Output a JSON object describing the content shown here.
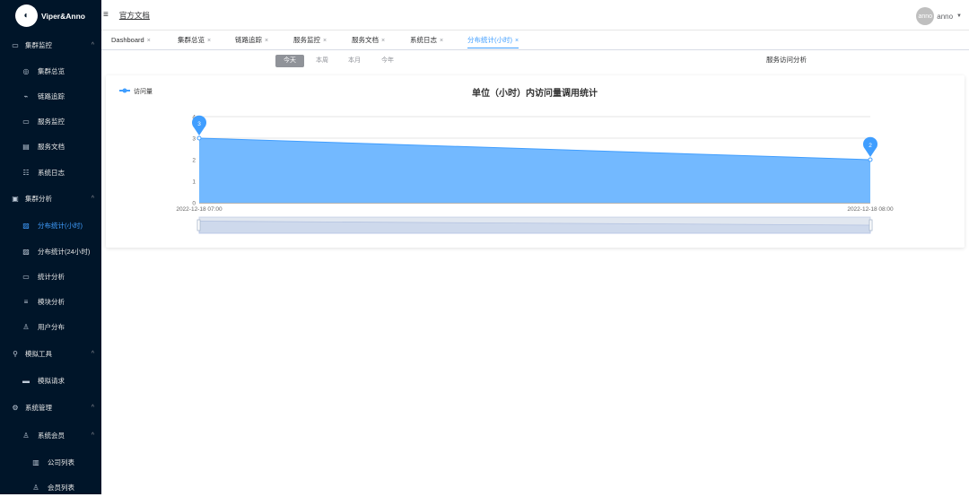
{
  "app": {
    "logo_text": "Viper&Anno"
  },
  "sidebar": {
    "items": [
      {
        "label": "集群监控",
        "icon": "monitor-icon",
        "type": "group"
      },
      {
        "label": "集群总览",
        "icon": "cluster-icon",
        "type": "item"
      },
      {
        "label": "链路追踪",
        "icon": "link-icon",
        "type": "item"
      },
      {
        "label": "服务监控",
        "icon": "monitor-icon",
        "type": "item"
      },
      {
        "label": "服务文档",
        "icon": "doc-icon",
        "type": "item"
      },
      {
        "label": "系统日志",
        "icon": "log-icon",
        "type": "item"
      },
      {
        "label": "集群分析",
        "icon": "analysis-icon",
        "type": "group"
      },
      {
        "label": "分布统计(小时)",
        "icon": "chart-icon",
        "type": "item",
        "active": true
      },
      {
        "label": "分布统计(24小时)",
        "icon": "chart-icon",
        "type": "item"
      },
      {
        "label": "统计分析",
        "icon": "monitor-icon",
        "type": "item"
      },
      {
        "label": "模块分析",
        "icon": "sliders-icon",
        "type": "item"
      },
      {
        "label": "用户分布",
        "icon": "user-icon",
        "type": "item"
      },
      {
        "label": "模拟工具",
        "icon": "tool-icon",
        "type": "group"
      },
      {
        "label": "模拟请求",
        "icon": "request-icon",
        "type": "item"
      },
      {
        "label": "系统管理",
        "icon": "gear-icon",
        "type": "group"
      },
      {
        "label": "系统会员",
        "icon": "user-icon",
        "type": "subgroup"
      },
      {
        "label": "公司列表",
        "icon": "company-icon",
        "type": "subitem"
      },
      {
        "label": "会员列表",
        "icon": "user-icon",
        "type": "subitem"
      }
    ]
  },
  "header": {
    "doc_link": "官方文档",
    "user_avatar": "anno",
    "user_name": "anno"
  },
  "tabs": [
    {
      "label": "Dashboard"
    },
    {
      "label": "集群总览"
    },
    {
      "label": "链路追踪"
    },
    {
      "label": "服务监控"
    },
    {
      "label": "服务文档"
    },
    {
      "label": "系统日志"
    },
    {
      "label": "分布统计(小时)",
      "active": true
    }
  ],
  "range": {
    "buttons": [
      "今天",
      "本周",
      "本月",
      "今年"
    ],
    "selected": "今天",
    "title": "服务访问分析"
  },
  "chart_data": {
    "type": "area",
    "title": "单位（小时）内访问量调用统计",
    "legend": [
      "访问量"
    ],
    "legend_position": "top-left",
    "categories": [
      "2022-12-18 07:00",
      "2022-12-18 08:00"
    ],
    "series": [
      {
        "name": "访问量",
        "values": [
          3,
          2
        ]
      }
    ],
    "ylim": [
      0,
      4
    ],
    "yticks": [
      0,
      1,
      2,
      3,
      4
    ],
    "markers": [
      3,
      2
    ],
    "color": "#409eff",
    "fill": "#73b9ff",
    "grid": true,
    "datazoom": true
  }
}
